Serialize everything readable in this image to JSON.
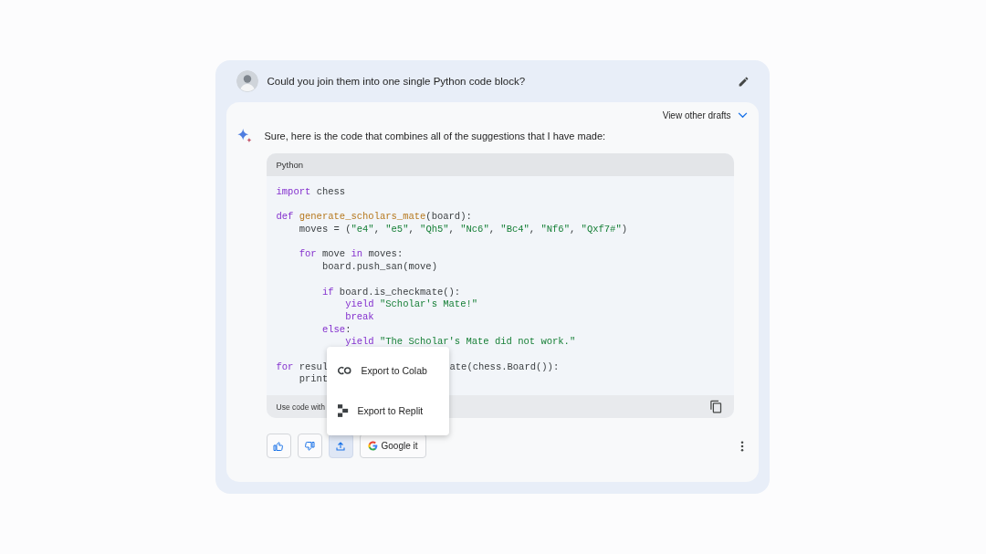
{
  "prompt": {
    "text": "Could you join them into one single Python code block?"
  },
  "response": {
    "drafts_label": "View other drafts",
    "intro": "Sure, here is the code that combines all of the suggestions that I have made:",
    "code": {
      "language": "Python",
      "lines": [
        {
          "kind": "code",
          "tokens": [
            {
              "kind": "kw",
              "t": "import"
            },
            {
              "kind": "txt",
              "t": " chess"
            }
          ]
        },
        {
          "kind": "blank"
        },
        {
          "kind": "code",
          "tokens": [
            {
              "kind": "kw",
              "t": "def"
            },
            {
              "kind": "fn",
              "t": " generate_scholars_mate"
            },
            {
              "kind": "txt",
              "t": "(board):"
            }
          ]
        },
        {
          "kind": "code",
          "tokens": [
            {
              "kind": "txt",
              "t": "    moves = ("
            },
            {
              "kind": "str",
              "t": "\"e4\""
            },
            {
              "kind": "txt",
              "t": ", "
            },
            {
              "kind": "str",
              "t": "\"e5\""
            },
            {
              "kind": "txt",
              "t": ", "
            },
            {
              "kind": "str",
              "t": "\"Qh5\""
            },
            {
              "kind": "txt",
              "t": ", "
            },
            {
              "kind": "str",
              "t": "\"Nc6\""
            },
            {
              "kind": "txt",
              "t": ", "
            },
            {
              "kind": "str",
              "t": "\"Bc4\""
            },
            {
              "kind": "txt",
              "t": ", "
            },
            {
              "kind": "str",
              "t": "\"Nf6\""
            },
            {
              "kind": "txt",
              "t": ", "
            },
            {
              "kind": "str",
              "t": "\"Qxf7#\""
            },
            {
              "kind": "txt",
              "t": ")"
            }
          ]
        },
        {
          "kind": "blank"
        },
        {
          "kind": "code",
          "tokens": [
            {
              "kind": "kw",
              "t": "    for"
            },
            {
              "kind": "txt",
              "t": " move "
            },
            {
              "kind": "kw",
              "t": "in"
            },
            {
              "kind": "txt",
              "t": " moves:"
            }
          ]
        },
        {
          "kind": "code",
          "tokens": [
            {
              "kind": "txt",
              "t": "        board.push_san(move)"
            }
          ]
        },
        {
          "kind": "blank"
        },
        {
          "kind": "code",
          "tokens": [
            {
              "kind": "kw",
              "t": "        if"
            },
            {
              "kind": "txt",
              "t": " board.is_checkmate():"
            }
          ]
        },
        {
          "kind": "code",
          "tokens": [
            {
              "kind": "kw",
              "t": "            yield"
            },
            {
              "kind": "str",
              "t": " \"Scholar's Mate!\""
            }
          ]
        },
        {
          "kind": "code",
          "tokens": [
            {
              "kind": "kw",
              "t": "            break"
            }
          ]
        },
        {
          "kind": "code",
          "tokens": [
            {
              "kind": "kw",
              "t": "        else"
            },
            {
              "kind": "txt",
              "t": ":"
            }
          ]
        },
        {
          "kind": "code",
          "tokens": [
            {
              "kind": "kw",
              "t": "            yield"
            },
            {
              "kind": "str",
              "t": " \"The Scholar's Mate did not work.\""
            }
          ]
        },
        {
          "kind": "blank"
        },
        {
          "kind": "code",
          "tokens": [
            {
              "kind": "kw",
              "t": "for"
            },
            {
              "kind": "txt",
              "t": " resul"
            }
          ],
          "tail": [
            {
              "kind": "txt",
              "t": "ate(chess.Board()):"
            }
          ]
        },
        {
          "kind": "code",
          "tokens": [
            {
              "kind": "txt",
              "t": "    print"
            }
          ]
        }
      ],
      "footer": "Use code with"
    },
    "export_menu": [
      {
        "kind": "colab",
        "label": "Export to Colab"
      },
      {
        "kind": "replit",
        "label": "Export to Replit"
      }
    ],
    "actions": [
      {
        "kind": "thumbs_up",
        "selected": false
      },
      {
        "kind": "thumbs_down",
        "selected": false
      },
      {
        "kind": "share",
        "selected": true
      },
      {
        "kind": "google",
        "label": "Google it",
        "selected": false
      }
    ]
  }
}
